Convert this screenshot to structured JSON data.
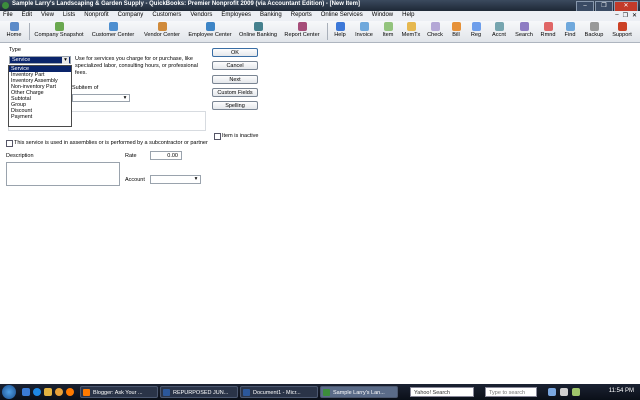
{
  "window": {
    "title": "Sample Larry's Landscaping & Garden Supply - QuickBooks: Premier Nonprofit 2009 (via Accountant Edition) - [New Item]"
  },
  "menu": [
    "File",
    "Edit",
    "View",
    "Lists",
    "Nonprofit",
    "Company",
    "Customers",
    "Vendors",
    "Employees",
    "Banking",
    "Reports",
    "Online Services",
    "Window",
    "Help"
  ],
  "toolbar": {
    "home": "Home",
    "company_snapshot": "Company Snapshot",
    "customer_center": "Customer Center",
    "vendor_center": "Vendor Center",
    "employee_center": "Employee Center",
    "online_banking": "Online Banking",
    "report_center": "Report Center",
    "help": "Help",
    "invoice": "Invoice",
    "item": "Item",
    "memtx": "MemTx",
    "check": "Check",
    "bill": "Bill",
    "reg": "Reg",
    "accnt": "Accnt",
    "search": "Search",
    "rmnd": "Rmnd",
    "find": "Find",
    "backup": "Backup",
    "support": "Support"
  },
  "form": {
    "type_label": "Type",
    "type_value": "Service",
    "type_help": "Use for services you charge for or purchase, like specialized labor, consulting hours, or professional fees.",
    "type_options": [
      "Service",
      "Inventory Part",
      "Inventory Assembly",
      "Non-inventory Part",
      "Other Charge",
      "Subtotal",
      "Group",
      "Discount",
      "Payment"
    ],
    "subitem_label": "Subitem of",
    "assembly_label": "This service is used in assemblies or is performed by a subcontractor or partner",
    "description_label": "Description",
    "rate_label": "Rate",
    "rate_value": "0.00",
    "account_label": "Account",
    "inactive_label": "Item is inactive"
  },
  "buttons": {
    "ok": "OK",
    "cancel": "Cancel",
    "next": "Next",
    "custom_fields": "Custom Fields",
    "spelling": "Spelling"
  },
  "taskbar": {
    "tasks": [
      "Blogger: Ask Your ...",
      "REPURPOSED JUN...",
      "Document1 - Micr...",
      "Sample Larry's Lan..."
    ],
    "yahoo_search": "Yahoo! Search",
    "search_placeholder": "Type to search",
    "clock": "11:54 PM"
  }
}
